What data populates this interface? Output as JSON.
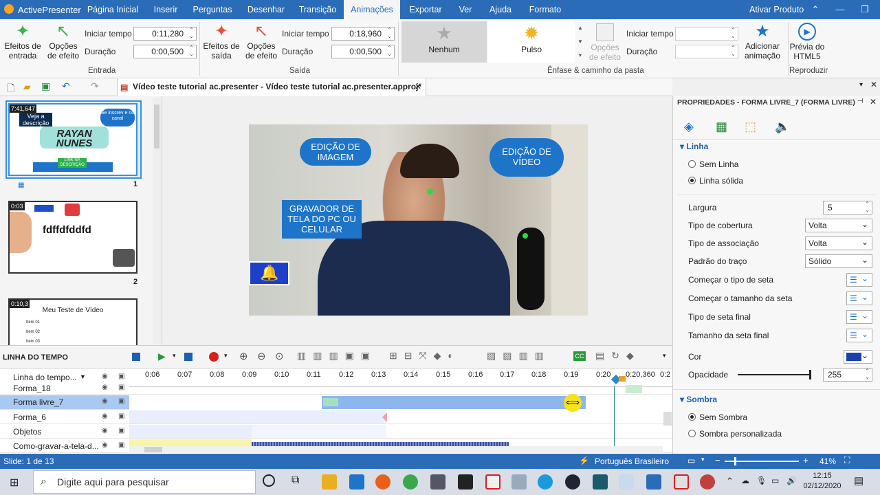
{
  "app": {
    "name": "ActivePresenter",
    "activate": "Ativar Produto"
  },
  "menu_tabs": [
    "Página Inicial",
    "Inserir",
    "Perguntas",
    "Desenhar",
    "Transição",
    "Animações",
    "Exportar",
    "Ver",
    "Ajuda",
    "Formato"
  ],
  "active_tab": "Animações",
  "ribbon": {
    "entrance": {
      "effects": "Efeitos de entrada",
      "options": "Opções de efeito",
      "start_label": "Iniciar tempo",
      "start_value": "0:11,280",
      "duration_label": "Duração",
      "duration_value": "0:00,500",
      "group": "Entrada"
    },
    "exit": {
      "effects": "Efeitos de saída",
      "options": "Opções de efeito",
      "start_label": "Iniciar tempo",
      "start_value": "0:18,960",
      "duration_label": "Duração",
      "duration_value": "0:00,500",
      "group": "Saída"
    },
    "emphasis": {
      "none": "Nenhum",
      "pulse": "Pulso",
      "options": "Opções de efeito",
      "start_label": "Iniciar tempo",
      "duration_label": "Duração",
      "add": "Adicionar animação",
      "group": "Ênfase & caminho da pasta"
    },
    "preview": {
      "label": "Prévia do HTML5",
      "group": "Reproduzir"
    }
  },
  "document_tab": "Vídeo teste tutorial ac.presenter - Vídeo teste tutorial ac.presenter.approj*",
  "slides": [
    {
      "time": "7:41,647",
      "number": "1",
      "label_a": "Veja a descrição",
      "label_b": "Se inscrev e no canal",
      "title": "RAYAN NUNES",
      "link": "LINK NA DESCRIÇÃO"
    },
    {
      "time": "0:03",
      "number": "2",
      "title": "fdffdfddfd"
    },
    {
      "time": "0:10,3",
      "title": "Meu Teste de Vídeo",
      "items": [
        "Item 01",
        "Item 02",
        "Item 03"
      ]
    }
  ],
  "video": {
    "bubble1": "EDIÇÃO DE IMAGEM",
    "bubble2": "EDIÇÃO DE VÍDEO",
    "bubble3": "GRAVADOR DE TELA DO PC OU CELULAR"
  },
  "properties": {
    "title": "PROPRIEDADES - FORMA LIVRE_7 (FORMA LIVRE)",
    "line_section": "Linha",
    "no_line": "Sem Linha",
    "solid_line": "Linha sólida",
    "width_label": "Largura",
    "width_value": "5",
    "cap_label": "Tipo de cobertura",
    "cap_value": "Volta",
    "join_label": "Tipo de associação",
    "join_value": "Volta",
    "dash_label": "Padrão do traço",
    "dash_value": "Sólido",
    "arrow_start_type": "Começar o tipo de seta",
    "arrow_start_size": "Começar o tamanho da seta",
    "arrow_end_type": "Tipo de seta final",
    "arrow_end_size": "Tamanho da seta final",
    "color_label": "Cor",
    "color_value": "#1b3fb0",
    "opacity_label": "Opacidade",
    "opacity_value": "255",
    "opacity_level": 1.0,
    "shadow_section": "Sombra",
    "no_shadow": "Sem Sombra",
    "custom_shadow": "Sombra personalizada"
  },
  "timeline": {
    "title": "LINHA DO TEMPO",
    "header": "Linha do tempo...",
    "ticks": [
      "0:06",
      "0:07",
      "0:08",
      "0:09",
      "0:10",
      "0:11",
      "0:12",
      "0:13",
      "0:14",
      "0:15",
      "0:16",
      "0:17",
      "0:18",
      "0:19",
      "0:20",
      "0:20,360",
      "0:2"
    ],
    "rows": [
      "Forma_18",
      "Forma livre_7",
      "Forma_6",
      "Objetos",
      "Como-gravar-a-tela-d..."
    ]
  },
  "status": {
    "slide": "Slide: 1 de 13",
    "language": "Português Brasileiro",
    "zoom": "41%"
  },
  "taskbar": {
    "search": "Digite aqui para pesquisar",
    "time": "12:15",
    "date": "02/12/2020"
  }
}
